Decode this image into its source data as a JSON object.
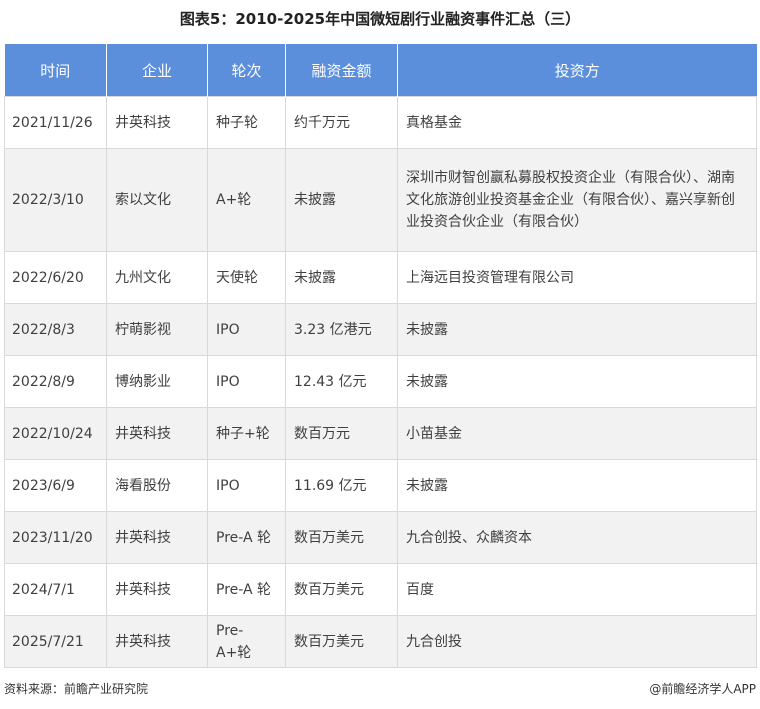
{
  "title": "图表5：2010-2025年中国微短剧行业融资事件汇总（三）",
  "table": {
    "headers": [
      "时间",
      "企业",
      "轮次",
      "融资金额",
      "投资方"
    ],
    "rows": [
      {
        "time": "2021/11/26",
        "company": "井英科技",
        "round": "种子轮",
        "amount": "约千万元",
        "investors": "真格基金"
      },
      {
        "time": "2022/3/10",
        "company": "索以文化",
        "round": "A+轮",
        "amount": "未披露",
        "investors": "深圳市财智创赢私募股权投资企业（有限合伙）、湖南文化旅游创业投资基金企业（有限合伙）、嘉兴享新创业投资合伙企业（有限合伙）"
      },
      {
        "time": "2022/6/20",
        "company": "九州文化",
        "round": "天使轮",
        "amount": "未披露",
        "investors": "上海远目投资管理有限公司"
      },
      {
        "time": "2022/8/3",
        "company": "柠萌影视",
        "round": "IPO",
        "amount": "3.23 亿港元",
        "investors": "未披露"
      },
      {
        "time": "2022/8/9",
        "company": "博纳影业",
        "round": "IPO",
        "amount": "12.43 亿元",
        "investors": "未披露"
      },
      {
        "time": "2022/10/24",
        "company": "井英科技",
        "round": "种子+轮",
        "amount": "数百万元",
        "investors": "小苗基金"
      },
      {
        "time": "2023/6/9",
        "company": "海看股份",
        "round": "IPO",
        "amount": "11.69 亿元",
        "investors": "未披露"
      },
      {
        "time": "2023/11/20",
        "company": "井英科技",
        "round": "Pre-A 轮",
        "amount": "数百万美元",
        "investors": "九合创投、众麟资本"
      },
      {
        "time": "2024/7/1",
        "company": "井英科技",
        "round": "Pre-A 轮",
        "amount": "数百万美元",
        "investors": "百度"
      },
      {
        "time": "2025/7/21",
        "company": "井英科技",
        "round": "Pre-A+轮",
        "amount": "数百万美元",
        "investors": "九合创投"
      }
    ]
  },
  "footer": {
    "source": "资料来源：前瞻产业研究院",
    "brand": "@前瞻经济学人APP"
  }
}
